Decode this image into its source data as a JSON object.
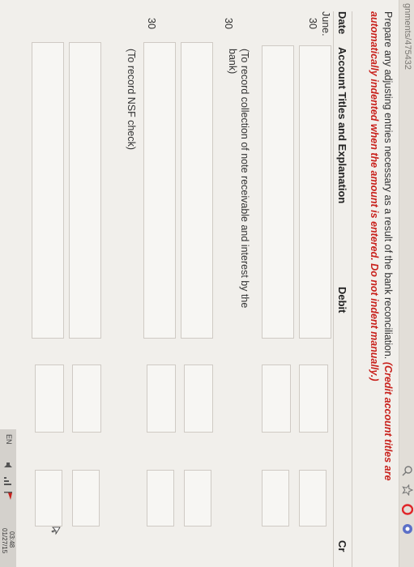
{
  "browser": {
    "url": "gnments/475432"
  },
  "instructions": {
    "text": "Prepare any adjusting entries necessary as a result of the bank reconciliation. ",
    "emphasis": "(Credit account titles are automatically indented when the amount is entered. Do not indent manually.)"
  },
  "table": {
    "headers": {
      "date": "Date",
      "account": "Account Titles and Explanation",
      "debit": "Debit",
      "credit": "Cr"
    },
    "dates": {
      "month": "June",
      "day1": "30",
      "day2": "30",
      "day3": "30"
    },
    "notes": {
      "collection": "(To record collection of note receivable and interest by the bank)",
      "nsf": "(To record NSF check)"
    }
  },
  "taskbar": {
    "lang": "EN",
    "time": "03:48",
    "date": "01/27/15"
  }
}
